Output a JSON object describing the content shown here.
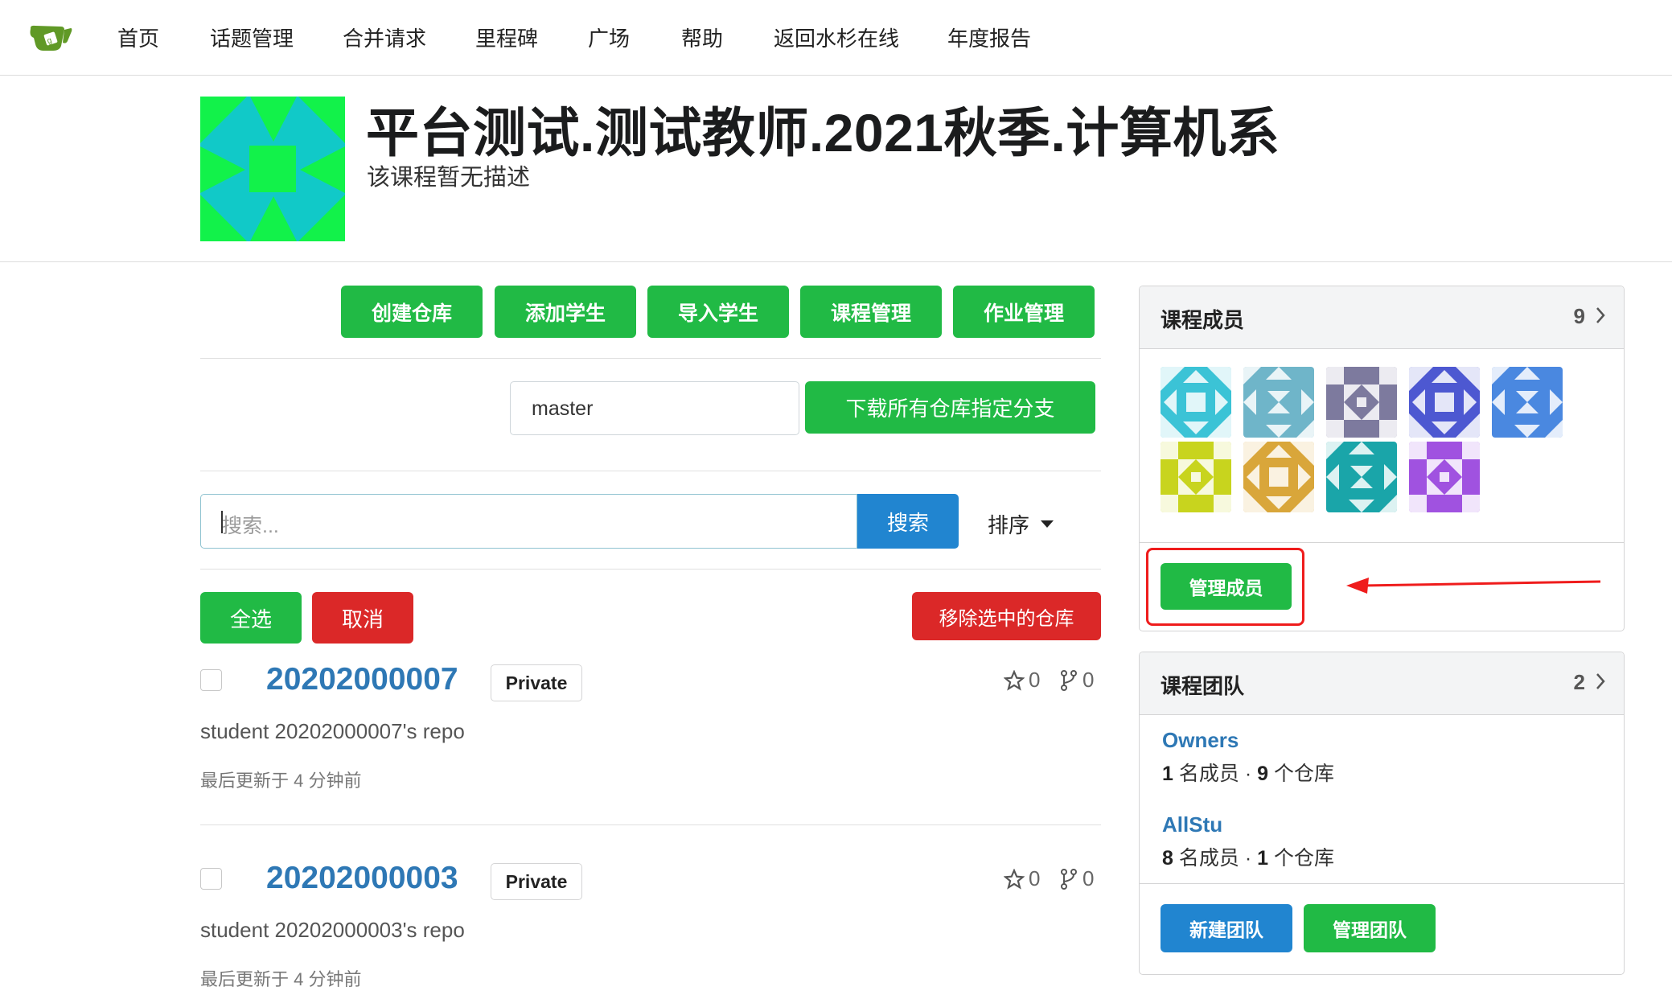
{
  "nav": {
    "items": [
      "首页",
      "话题管理",
      "合并请求",
      "里程碑",
      "广场",
      "帮助",
      "返回水杉在线",
      "年度报告"
    ]
  },
  "course": {
    "title": "平台测试.测试教师.2021秋季.计算机系",
    "description": "该课程暂无描述"
  },
  "actions": {
    "create_repo": "创建仓库",
    "add_students": "添加学生",
    "import_students": "导入学生",
    "course_manage": "课程管理",
    "assignment_manage": "作业管理"
  },
  "branch": {
    "value": "master",
    "download_label": "下载所有仓库指定分支"
  },
  "search": {
    "placeholder": "搜索...",
    "button": "搜索",
    "sort_label": "排序"
  },
  "bulk": {
    "select_all": "全选",
    "cancel": "取消",
    "remove_selected": "移除选中的仓库"
  },
  "repos": [
    {
      "name": "20202000007",
      "visibility": "Private",
      "stars": "0",
      "forks": "0",
      "description": "student 20202000007's repo",
      "updated": "最后更新于 4 分钟前"
    },
    {
      "name": "20202000003",
      "visibility": "Private",
      "stars": "0",
      "forks": "0",
      "description": "student 20202000003's repo",
      "updated": "最后更新于 4 分钟前"
    }
  ],
  "members_card": {
    "title": "课程成员",
    "count": "9",
    "manage_label": "管理成员",
    "avatar_colors": [
      "#3bc3d6",
      "#6fb5c9",
      "#7d7a9e",
      "#4d58d1",
      "#4a88e0",
      "#c8d41e",
      "#d9a63a",
      "#1aa5a9",
      "#a052e0"
    ]
  },
  "teams_card": {
    "title": "课程团队",
    "count": "2",
    "teams": [
      {
        "name": "Owners",
        "members_num": "1",
        "members_label": "名成员",
        "repos_num": "9",
        "repos_label": "个仓库"
      },
      {
        "name": "AllStu",
        "members_num": "8",
        "members_label": "名成员",
        "repos_num": "1",
        "repos_label": "个仓库"
      }
    ],
    "new_team": "新建团队",
    "manage_team": "管理团队"
  },
  "colors": {
    "green": "#21ba45",
    "red": "#db2828",
    "blue": "#2185d0",
    "link": "#2e78b5",
    "annotation": "#ef1c1c"
  }
}
